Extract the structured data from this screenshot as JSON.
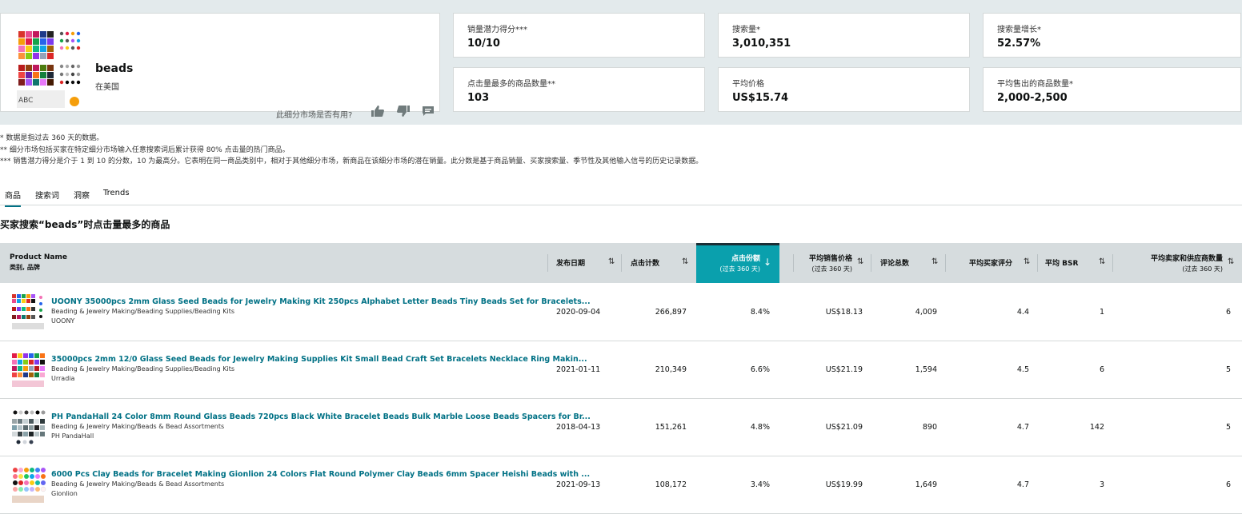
{
  "market": {
    "name": "beads",
    "location": "在美国",
    "feedback_prompt": "此细分市场是否有用?"
  },
  "metrics": [
    {
      "label": "销量潜力得分***",
      "value": "10/10"
    },
    {
      "label": "搜索量*",
      "value": "3,010,351"
    },
    {
      "label": "搜索量增长*",
      "value": "52.57%"
    },
    {
      "label": "点击量最多的商品数量**",
      "value": "103"
    },
    {
      "label": "平均价格",
      "value": "US$15.74"
    },
    {
      "label": "平均售出的商品数量*",
      "value": "2,000-2,500"
    }
  ],
  "notes": [
    "* 数据是指过去 360 天的数据。",
    "** 细分市场包括买家在特定细分市场输入任意搜索词后累计获得 80% 点击量的热门商品。",
    "*** 销售潜力得分是介于 1 到 10 的分数，10 为最高分。它表明在同一商品类别中，相对于其他细分市场，新商品在该细分市场的潜在销量。此分数是基于商品销量、买家搜索量、季节性及其他输入信号的历史记录数据。"
  ],
  "tabs": [
    "商品",
    "搜索词",
    "洞察",
    "Trends"
  ],
  "section_title": "买家搜索“beads”时点击量最多的商品",
  "columns": {
    "product": "Product Name",
    "product_sub": "类别, 品牌",
    "date": "发布日期",
    "clicks": "点击计数",
    "share": "点击份额",
    "share_sub": "(过去 360 天)",
    "price": "平均销售价格",
    "price_sub": "(过去 360 天)",
    "reviews": "评论总数",
    "rating": "平均买家评分",
    "bsr": "平均 BSR",
    "sellers": "平均卖家和供应商数量",
    "sellers_sub": "(过去 360 天)"
  },
  "rows": [
    {
      "title": "UOONY 35000pcs 2mm Glass Seed Beads for Jewelry Making Kit 250pcs Alphabet Letter Beads Tiny Beads Set for Bracelets...",
      "category": "Beading & Jewelry Making/Beading Supplies/Beading Kits",
      "brand": "UOONY",
      "date": "2020-09-04",
      "clicks": "266,897",
      "share": "8.4%",
      "price": "US$18.13",
      "reviews": "4,009",
      "rating": "4.4",
      "bsr": "1",
      "sellers": "6"
    },
    {
      "title": "35000pcs 2mm 12/0 Glass Seed Beads for Jewelry Making Supplies Kit Small Bead Craft Set Bracelets Necklace Ring Makin...",
      "category": "Beading & Jewelry Making/Beading Supplies/Beading Kits",
      "brand": "Urradia",
      "date": "2021-01-11",
      "clicks": "210,349",
      "share": "6.6%",
      "price": "US$21.19",
      "reviews": "1,594",
      "rating": "4.5",
      "bsr": "6",
      "sellers": "5"
    },
    {
      "title": "PH PandaHall 24 Color 8mm Round Glass Beads 720pcs Black White Bracelet Beads Bulk Marble Loose Beads Spacers for Br...",
      "category": "Beading & Jewelry Making/Beads & Bead Assortments",
      "brand": "PH PandaHall",
      "date": "2018-04-13",
      "clicks": "151,261",
      "share": "4.8%",
      "price": "US$21.09",
      "reviews": "890",
      "rating": "4.7",
      "bsr": "142",
      "sellers": "5"
    },
    {
      "title": "6000 Pcs Clay Beads for Bracelet Making Gionlion 24 Colors Flat Round Polymer Clay Beads 6mm Spacer Heishi Beads with ...",
      "category": "Beading & Jewelry Making/Beads & Bead Assortments",
      "brand": "Gionlion",
      "date": "2021-09-13",
      "clicks": "108,172",
      "share": "3.4%",
      "price": "US$19.99",
      "reviews": "1,649",
      "rating": "4.7",
      "bsr": "3",
      "sellers": "6"
    }
  ],
  "colors": {
    "accent": "#0aa0ad",
    "link": "#007185",
    "header_bg": "#d6dcde",
    "top_bg": "#e3eaec"
  }
}
